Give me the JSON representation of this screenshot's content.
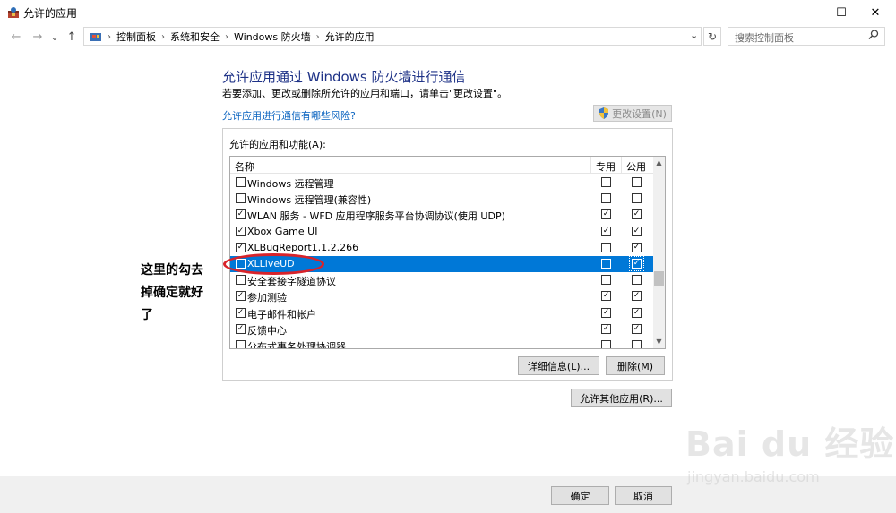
{
  "window": {
    "title": "允许的应用",
    "minimize_glyph": "—",
    "maximize_glyph": "☐",
    "close_glyph": "✕"
  },
  "nav": {
    "back_glyph": "←",
    "forward_glyph": "→",
    "recent_glyph": "⌄",
    "up_glyph": "↑"
  },
  "address": {
    "crumbs": [
      "控制面板",
      "系统和安全",
      "Windows 防火墙",
      "允许的应用"
    ],
    "separator": "›",
    "dropdown_glyph": "⌄",
    "refresh_glyph": "↻"
  },
  "search": {
    "placeholder": "搜索控制面板"
  },
  "main": {
    "heading": "允许应用通过 Windows 防火墙进行通信",
    "subtext": "若要添加、更改或删除所允许的应用和端口，请单击\"更改设置\"。",
    "risk_link": "允许应用进行通信有哪些风险?",
    "change_settings": "更改设置(N)",
    "group_label": "允许的应用和功能(A):",
    "columns": {
      "name": "名称",
      "private": "专用",
      "public": "公用"
    },
    "rows": [
      {
        "name": "Windows 远程管理",
        "checked": false,
        "private": false,
        "public": false,
        "selected": false
      },
      {
        "name": "Windows 远程管理(兼容性)",
        "checked": false,
        "private": false,
        "public": false,
        "selected": false
      },
      {
        "name": "WLAN 服务 - WFD 应用程序服务平台协调协议(使用 UDP)",
        "checked": true,
        "private": true,
        "public": true,
        "selected": false
      },
      {
        "name": "Xbox Game UI",
        "checked": true,
        "private": true,
        "public": true,
        "selected": false
      },
      {
        "name": "XLBugReport1.1.2.266",
        "checked": true,
        "private": false,
        "public": true,
        "selected": false
      },
      {
        "name": "XLLiveUD",
        "checked": false,
        "private": false,
        "public": true,
        "selected": true
      },
      {
        "name": "安全套接字隧道协议",
        "checked": false,
        "private": false,
        "public": false,
        "selected": false
      },
      {
        "name": "参加测验",
        "checked": true,
        "private": true,
        "public": true,
        "selected": false
      },
      {
        "name": "电子邮件和帐户",
        "checked": true,
        "private": true,
        "public": true,
        "selected": false
      },
      {
        "name": "反馈中心",
        "checked": true,
        "private": true,
        "public": true,
        "selected": false
      },
      {
        "name": "分布式事务处理协调器",
        "checked": false,
        "private": false,
        "public": false,
        "selected": false
      }
    ],
    "details_button": "详细信息(L)...",
    "delete_button": "删除(M)",
    "allow_other_button": "允许其他应用(R)...",
    "scroll_up_glyph": "▲",
    "scroll_down_glyph": "▼"
  },
  "footer": {
    "ok": "确定",
    "cancel": "取消"
  },
  "annotation": {
    "text": "这里的勾去掉确定就好了"
  },
  "watermark": {
    "main": "Bai du 经验",
    "sub": "jingyan.baidu.com"
  },
  "colors": {
    "selection": "#0078d7",
    "heading": "#1e3287",
    "link": "#0b64c0",
    "annotation_red": "#d8232a"
  }
}
